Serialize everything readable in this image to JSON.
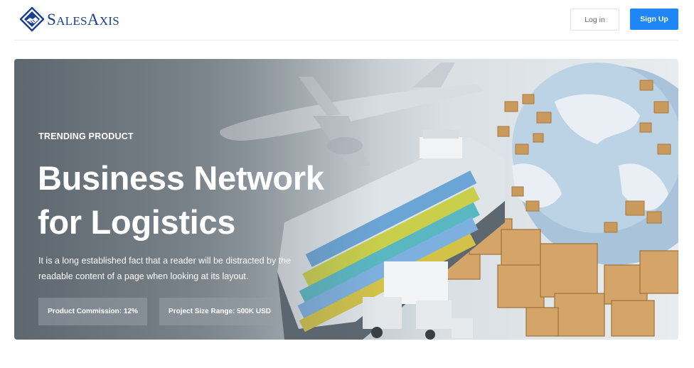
{
  "header": {
    "brand": {
      "first_cap": "S",
      "first_rest": "ALES",
      "second_cap": "A",
      "second_rest": "XIS"
    },
    "login_label": "Log in",
    "signup_label": "Sign Up"
  },
  "hero": {
    "eyebrow": "TRENDING PRODUCT",
    "title_line1": "Business Network",
    "title_line2": "for Logistics",
    "description": "It is a long established fact that a reader will be distracted by the readable content of a page when looking at its layout.",
    "stats": [
      {
        "label": "Product Commission: 12%"
      },
      {
        "label": "Project Size Range: 500K USD"
      }
    ]
  },
  "colors": {
    "brand": "#1b3f8f",
    "accent": "#1f86f5"
  },
  "icons": {
    "logo": "handshake-diamond-icon"
  }
}
